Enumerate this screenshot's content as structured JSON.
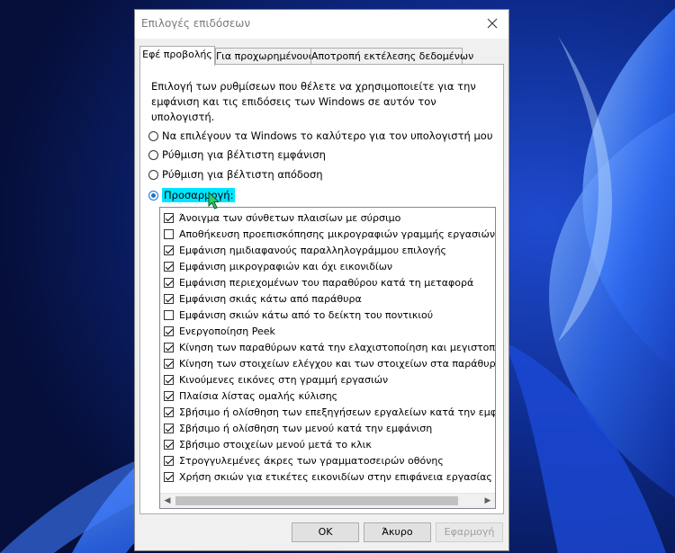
{
  "window": {
    "title": "Επιλογές επιδόσεων"
  },
  "tabs": [
    {
      "label": "Εφέ προβολής",
      "active": true
    },
    {
      "label": "Για προχωρημένους",
      "active": false
    },
    {
      "label": "Αποτροπή εκτέλεσης δεδομένων",
      "active": false
    }
  ],
  "visual_effects": {
    "description_line1": "Επιλογή των ρυθμίσεων που θέλετε να χρησιμοποιείτε για την",
    "description_line2": "εμφάνιση και τις επιδόσεις των Windows σε αυτόν τον υπολογιστή.",
    "radios": [
      {
        "label": "Να επιλέγουν τα Windows το καλύτερο για τον υπολογιστή μου",
        "checked": false
      },
      {
        "label": "Ρύθμιση για βέλτιστη εμφάνιση",
        "checked": false
      },
      {
        "label": "Ρύθμιση για βέλτιστη απόδοση",
        "checked": false
      },
      {
        "label": "Προσαρμογή:",
        "checked": true
      }
    ],
    "options": [
      {
        "label": "Άνοιγμα των σύνθετων πλαισίων με σύρσιμο",
        "checked": true
      },
      {
        "label": "Αποθήκευση προεπισκόπησης μικρογραφιών γραμμής εργασιών",
        "checked": false
      },
      {
        "label": "Εμφάνιση ημιδιαφανούς παραλληλογράμμου επιλογής",
        "checked": true
      },
      {
        "label": "Εμφάνιση μικρογραφιών και όχι εικονιδίων",
        "checked": true
      },
      {
        "label": "Εμφάνιση περιεχομένων του παραθύρου κατά τη μεταφορά",
        "checked": true
      },
      {
        "label": "Εμφάνιση σκιάς κάτω από παράθυρα",
        "checked": true
      },
      {
        "label": "Εμφάνιση σκιών κάτω από το δείκτη του ποντικιού",
        "checked": false
      },
      {
        "label": "Ενεργοποίηση Peek",
        "checked": true
      },
      {
        "label": "Κίνηση των παραθύρων κατά την ελαχιστοποίηση και μεγιστοποίηση",
        "checked": true
      },
      {
        "label": "Κίνηση των στοιχείων ελέγχου και των στοιχείων στα παράθυρα",
        "checked": true
      },
      {
        "label": "Κινούμενες εικόνες στη γραμμή εργασιών",
        "checked": true
      },
      {
        "label": "Πλαίσια λίστας ομαλής κύλισης",
        "checked": true
      },
      {
        "label": "Σβήσιμο ή ολίσθηση των επεξηγήσεων εργαλείων κατά την εμφάνιση",
        "checked": true
      },
      {
        "label": "Σβήσιμο ή ολίσθηση των μενού κατά την εμφάνιση",
        "checked": true
      },
      {
        "label": "Σβήσιμο στοιχείων μενού μετά το κλικ",
        "checked": true
      },
      {
        "label": "Στρογγυλεμένες άκρες των γραμματοσειρών οθόνης",
        "checked": true
      },
      {
        "label": "Χρήση σκιών για ετικέτες εικονιδίων στην επιφάνεια εργασίας",
        "checked": true
      }
    ]
  },
  "buttons": {
    "ok": "OK",
    "cancel": "Άκυρο",
    "apply": "Εφαρμογή"
  },
  "colors": {
    "highlight": "#00e5ff",
    "accent": "#1a73d9",
    "cursor": "#2fcc6f"
  }
}
